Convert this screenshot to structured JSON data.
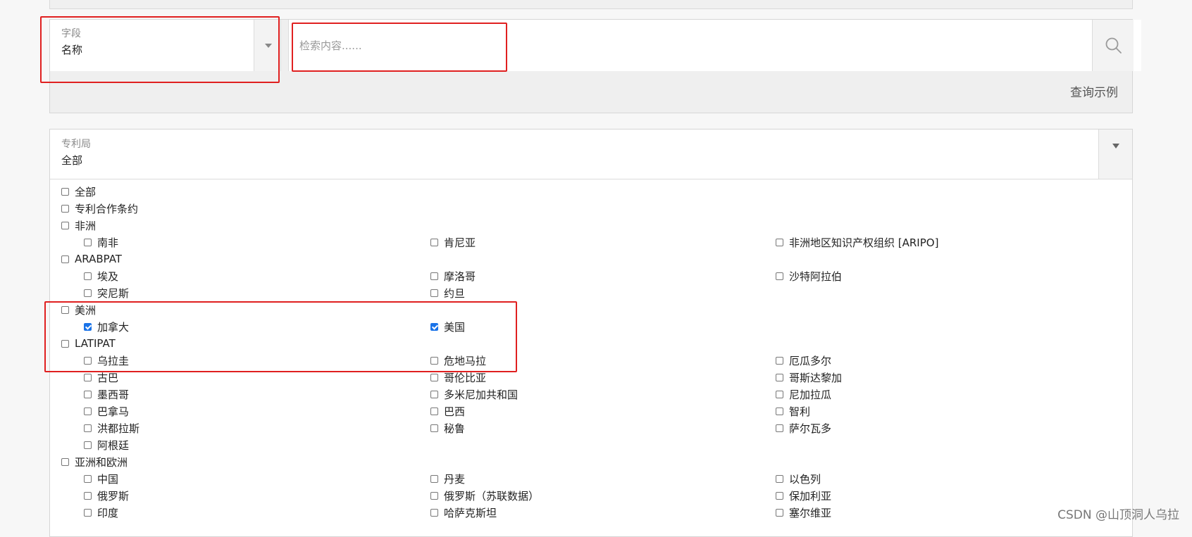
{
  "field_select": {
    "label": "字段",
    "value": "名称"
  },
  "search": {
    "placeholder": "检索内容......"
  },
  "example_link": "查询示例",
  "office_select": {
    "label": "专利局",
    "value": "全部"
  },
  "office_options": [
    {
      "label": "全部",
      "checked": false,
      "level": 0,
      "col": 0,
      "row": 0
    },
    {
      "label": "专利合作条约",
      "checked": false,
      "level": 0,
      "col": 0,
      "row": 1
    },
    {
      "label": "非洲",
      "checked": false,
      "level": 0,
      "col": 0,
      "row": 2
    },
    {
      "label": "南非",
      "checked": false,
      "level": 1,
      "col": 0,
      "row": 3
    },
    {
      "label": "肯尼亚",
      "checked": false,
      "level": 1,
      "col": 1,
      "row": 3
    },
    {
      "label": "非洲地区知识产权组织 [ARIPO]",
      "checked": false,
      "level": 1,
      "col": 2,
      "row": 3
    },
    {
      "label": "ARABPAT",
      "checked": false,
      "level": 0,
      "col": 0,
      "row": 4
    },
    {
      "label": "埃及",
      "checked": false,
      "level": 1,
      "col": 0,
      "row": 5
    },
    {
      "label": "摩洛哥",
      "checked": false,
      "level": 1,
      "col": 1,
      "row": 5
    },
    {
      "label": "沙特阿拉伯",
      "checked": false,
      "level": 1,
      "col": 2,
      "row": 5
    },
    {
      "label": "突尼斯",
      "checked": false,
      "level": 1,
      "col": 0,
      "row": 6
    },
    {
      "label": "约旦",
      "checked": false,
      "level": 1,
      "col": 1,
      "row": 6
    },
    {
      "label": "美洲",
      "checked": false,
      "level": 0,
      "col": 0,
      "row": 7
    },
    {
      "label": "加拿大",
      "checked": true,
      "level": 1,
      "col": 0,
      "row": 8
    },
    {
      "label": "美国",
      "checked": true,
      "level": 1,
      "col": 1,
      "row": 8
    },
    {
      "label": "LATIPAT",
      "checked": false,
      "level": 0,
      "col": 0,
      "row": 9
    },
    {
      "label": "乌拉圭",
      "checked": false,
      "level": 1,
      "col": 0,
      "row": 10
    },
    {
      "label": "危地马拉",
      "checked": false,
      "level": 1,
      "col": 1,
      "row": 10
    },
    {
      "label": "厄瓜多尔",
      "checked": false,
      "level": 1,
      "col": 2,
      "row": 10
    },
    {
      "label": "古巴",
      "checked": false,
      "level": 1,
      "col": 0,
      "row": 11
    },
    {
      "label": "哥伦比亚",
      "checked": false,
      "level": 1,
      "col": 1,
      "row": 11
    },
    {
      "label": "哥斯达黎加",
      "checked": false,
      "level": 1,
      "col": 2,
      "row": 11
    },
    {
      "label": "墨西哥",
      "checked": false,
      "level": 1,
      "col": 0,
      "row": 12
    },
    {
      "label": "多米尼加共和国",
      "checked": false,
      "level": 1,
      "col": 1,
      "row": 12
    },
    {
      "label": "尼加拉瓜",
      "checked": false,
      "level": 1,
      "col": 2,
      "row": 12
    },
    {
      "label": "巴拿马",
      "checked": false,
      "level": 1,
      "col": 0,
      "row": 13
    },
    {
      "label": "巴西",
      "checked": false,
      "level": 1,
      "col": 1,
      "row": 13
    },
    {
      "label": "智利",
      "checked": false,
      "level": 1,
      "col": 2,
      "row": 13
    },
    {
      "label": "洪都拉斯",
      "checked": false,
      "level": 1,
      "col": 0,
      "row": 14
    },
    {
      "label": "秘鲁",
      "checked": false,
      "level": 1,
      "col": 1,
      "row": 14
    },
    {
      "label": "萨尔瓦多",
      "checked": false,
      "level": 1,
      "col": 2,
      "row": 14
    },
    {
      "label": "阿根廷",
      "checked": false,
      "level": 1,
      "col": 0,
      "row": 15
    },
    {
      "label": "亚洲和欧洲",
      "checked": false,
      "level": 0,
      "col": 0,
      "row": 16
    },
    {
      "label": "中国",
      "checked": false,
      "level": 1,
      "col": 0,
      "row": 17
    },
    {
      "label": "丹麦",
      "checked": false,
      "level": 1,
      "col": 1,
      "row": 17
    },
    {
      "label": "以色列",
      "checked": false,
      "level": 1,
      "col": 2,
      "row": 17
    },
    {
      "label": "俄罗斯",
      "checked": false,
      "level": 1,
      "col": 0,
      "row": 18
    },
    {
      "label": "俄罗斯（苏联数据）",
      "checked": false,
      "level": 1,
      "col": 1,
      "row": 18
    },
    {
      "label": "保加利亚",
      "checked": false,
      "level": 1,
      "col": 2,
      "row": 18
    },
    {
      "label": "印度",
      "checked": false,
      "level": 1,
      "col": 0,
      "row": 19
    },
    {
      "label": "哈萨克斯坦",
      "checked": false,
      "level": 1,
      "col": 1,
      "row": 19
    },
    {
      "label": "塞尔维亚",
      "checked": false,
      "level": 1,
      "col": 2,
      "row": 19
    }
  ],
  "watermark": "CSDN @山顶洞人乌拉",
  "colors": {
    "annotation_red": "#e02020",
    "checkbox_checked": "#1a73e8"
  }
}
